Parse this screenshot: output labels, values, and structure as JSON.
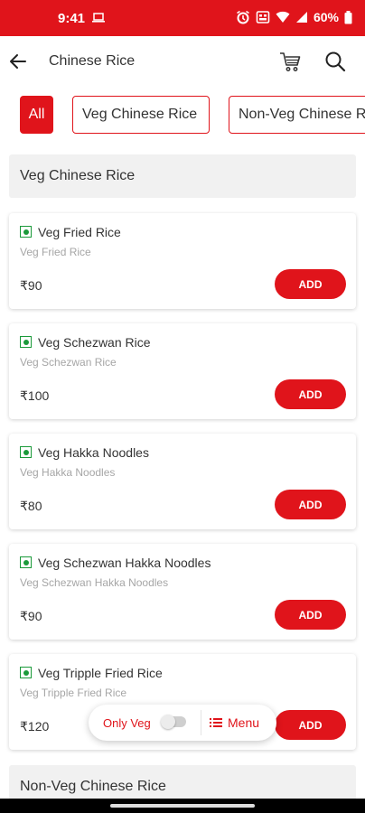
{
  "status_bar": {
    "time": "9:41",
    "battery": "60%"
  },
  "app_bar": {
    "title": "Chinese Rice"
  },
  "filters": {
    "all": "All",
    "veg": "Veg Chinese Rice",
    "nonveg": "Non-Veg Chinese Rice"
  },
  "sections": [
    {
      "title": "Veg Chinese Rice"
    },
    {
      "title": "Non-Veg Chinese Rice"
    }
  ],
  "items": [
    {
      "name": "Veg Fried Rice",
      "description": "Veg Fried Rice",
      "price": "₹90",
      "button": "ADD"
    },
    {
      "name": "Veg Schezwan Rice",
      "description": "Veg Schezwan Rice",
      "price": "₹100",
      "button": "ADD"
    },
    {
      "name": "Veg Hakka Noodles",
      "description": "Veg Hakka Noodles",
      "price": "₹80",
      "button": "ADD"
    },
    {
      "name": "Veg Schezwan Hakka Noodles",
      "description": "Veg Schezwan Hakka Noodles",
      "price": "₹90",
      "button": "ADD"
    },
    {
      "name": "Veg Tripple Fried Rice",
      "description": "Veg Tripple Fried Rice",
      "price": "₹120",
      "button": "ADD"
    }
  ],
  "floating_bar": {
    "only_veg_label": "Only Veg",
    "only_veg_enabled": false,
    "menu_label": "Menu"
  },
  "colors": {
    "accent": "#e0141b",
    "veg_green": "#1a9a3a"
  }
}
